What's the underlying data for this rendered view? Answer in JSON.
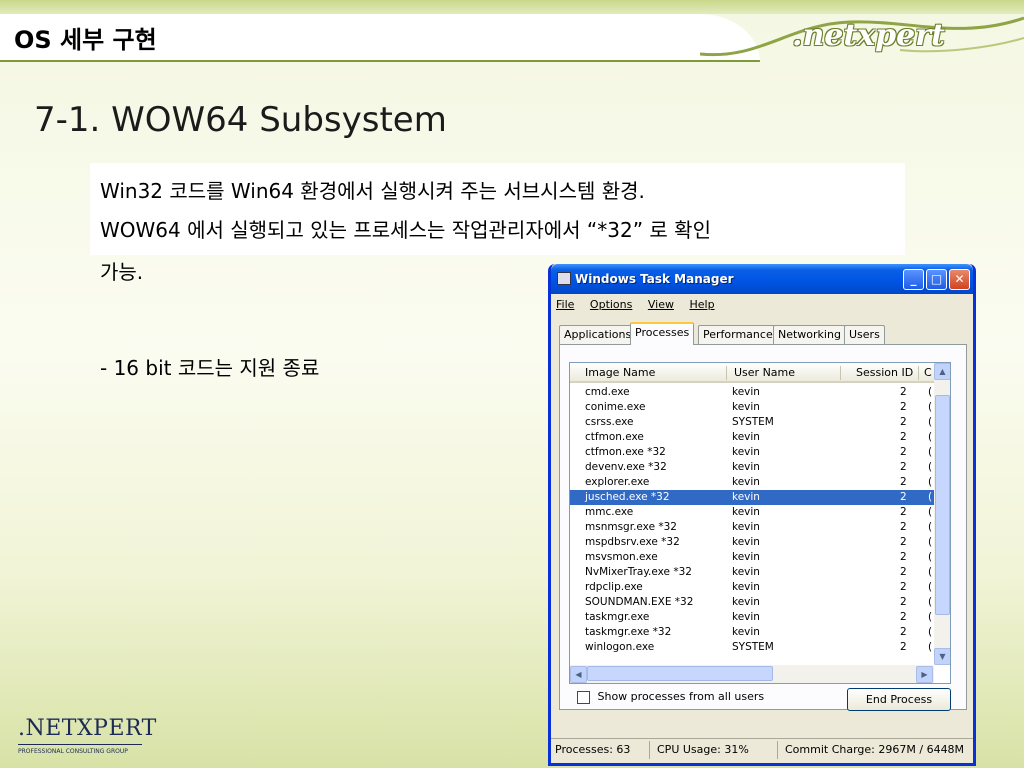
{
  "slide": {
    "section_title": "OS 세부 구현",
    "brand": ".netxpert",
    "heading": "7-1. WOW64 Subsystem",
    "body": {
      "line1": "Win32 코드를 Win64 환경에서 실행시켜 주는 서브시스템 환경.",
      "line2": "WOW64 에서 실행되고 있는 프로세스는 작업관리자에서  “*32” 로 확인",
      "line3": "가능.",
      "bullet": "- 16 bit 코드는 지원 종료"
    },
    "footer_logo": {
      "main": ".NETXPERT",
      "sub": "PROFESSIONAL CONSULTING GROUP"
    }
  },
  "task_manager": {
    "title": "Windows Task Manager",
    "window_buttons": {
      "minimize": "_",
      "maximize": "□",
      "close": "✕"
    },
    "menu": [
      "File",
      "Options",
      "View",
      "Help"
    ],
    "tabs": [
      "Applications",
      "Processes",
      "Performance",
      "Networking",
      "Users"
    ],
    "active_tab": "Processes",
    "columns": [
      "Image Name",
      "User Name",
      "Session ID",
      "C"
    ],
    "processes": [
      {
        "image": "cmd.exe",
        "user": "kevin",
        "session": "2",
        "c": "("
      },
      {
        "image": "conime.exe",
        "user": "kevin",
        "session": "2",
        "c": "("
      },
      {
        "image": "csrss.exe",
        "user": "SYSTEM",
        "session": "2",
        "c": "("
      },
      {
        "image": "ctfmon.exe",
        "user": "kevin",
        "session": "2",
        "c": "("
      },
      {
        "image": "ctfmon.exe *32",
        "user": "kevin",
        "session": "2",
        "c": "("
      },
      {
        "image": "devenv.exe *32",
        "user": "kevin",
        "session": "2",
        "c": "("
      },
      {
        "image": "explorer.exe",
        "user": "kevin",
        "session": "2",
        "c": "("
      },
      {
        "image": "jusched.exe *32",
        "user": "kevin",
        "session": "2",
        "c": "(",
        "selected": true
      },
      {
        "image": "mmc.exe",
        "user": "kevin",
        "session": "2",
        "c": "("
      },
      {
        "image": "msnmsgr.exe *32",
        "user": "kevin",
        "session": "2",
        "c": "("
      },
      {
        "image": "mspdbsrv.exe *32",
        "user": "kevin",
        "session": "2",
        "c": "("
      },
      {
        "image": "msvsmon.exe",
        "user": "kevin",
        "session": "2",
        "c": "("
      },
      {
        "image": "NvMixerTray.exe *32",
        "user": "kevin",
        "session": "2",
        "c": "("
      },
      {
        "image": "rdpclip.exe",
        "user": "kevin",
        "session": "2",
        "c": "("
      },
      {
        "image": "SOUNDMAN.EXE *32",
        "user": "kevin",
        "session": "2",
        "c": "("
      },
      {
        "image": "taskmgr.exe",
        "user": "kevin",
        "session": "2",
        "c": "("
      },
      {
        "image": "taskmgr.exe *32",
        "user": "kevin",
        "session": "2",
        "c": "("
      },
      {
        "image": "winlogon.exe",
        "user": "SYSTEM",
        "session": "2",
        "c": "("
      }
    ],
    "show_all_label": "Show processes from all users",
    "show_all_checked": false,
    "end_process_label": "End Process",
    "status": {
      "processes": "Processes: 63",
      "cpu": "CPU Usage: 31%",
      "commit": "Commit Charge: 2967M / 6448M"
    }
  }
}
